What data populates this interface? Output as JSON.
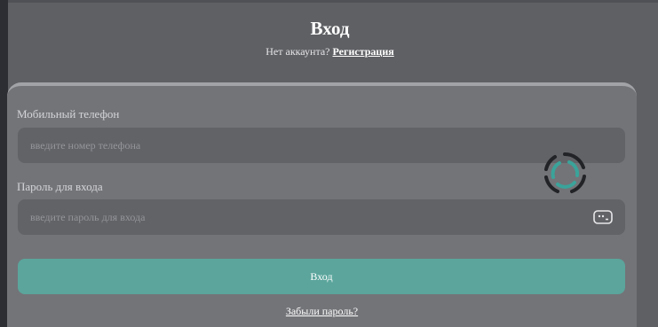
{
  "header": {
    "title": "Вход",
    "no_account_text": "Нет аккаунта?",
    "register_link": "Регистрация"
  },
  "form": {
    "phone": {
      "label": "Мобильный телефон",
      "placeholder": "введите номер телефона",
      "value": ""
    },
    "password": {
      "label": "Пароль для входа",
      "placeholder": "введите пароль для входа",
      "value": ""
    },
    "submit_label": "Вход",
    "forgot_link": "Забыли пароль?"
  },
  "colors": {
    "background": "#5f6064",
    "card": "#737478",
    "input": "#626367",
    "accent": "#5ba59c",
    "spinner_accent": "#3aa39a",
    "spinner_dark": "#222327"
  },
  "icons": {
    "password_toggle": "keyboard-icon",
    "loading": "loading-spinner-icon"
  }
}
